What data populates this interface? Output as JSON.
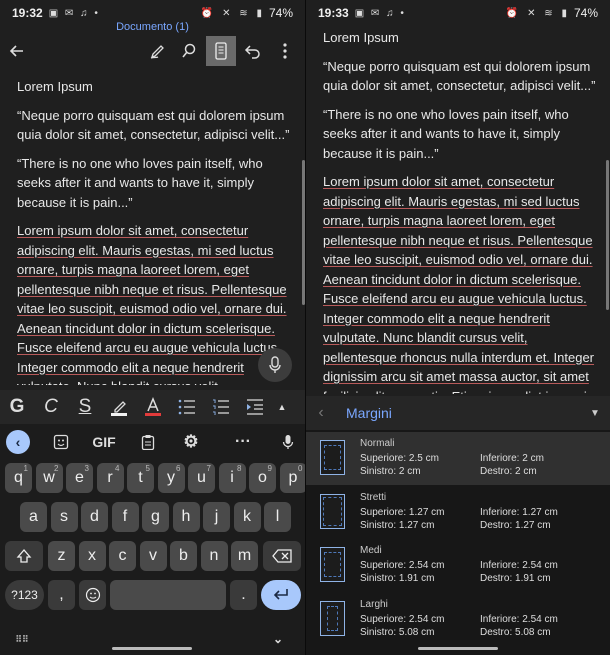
{
  "left": {
    "status": {
      "time": "19:32",
      "battery": "74%"
    },
    "doc_title": "Documento (1)",
    "doc": {
      "heading": "Lorem Ipsum",
      "quote1": "“Neque porro quisquam est qui dolorem ipsum quia dolor sit amet, consectetur, adipisci velit...”",
      "quote2": "“There is no one who loves pain itself, who seeks after it and wants to have it, simply because it is pain...”",
      "body": "Lorem ipsum dolor sit amet, consectetur adipiscing elit. Mauris egestas, mi sed luctus ornare, turpis magna laoreet lorem, eget pellentesque nibh neque et risus. Pellentesque vitae leo suscipit, euismod odio vel, ornare dui. Aenean tincidunt dolor in dictum scelerisque. Fusce eleifend arcu eu augue vehicula luctus. Integer commodo elit a neque hendrerit vulputate. Nunc blandit cursus velit,"
    },
    "format_bar": {
      "bold": "G",
      "italic": "C",
      "underline": "S"
    },
    "keyboard": {
      "gif": "GIF",
      "row1": [
        {
          "k": "q",
          "h": "1"
        },
        {
          "k": "w",
          "h": "2"
        },
        {
          "k": "e",
          "h": "3"
        },
        {
          "k": "r",
          "h": "4"
        },
        {
          "k": "t",
          "h": "5"
        },
        {
          "k": "y",
          "h": "6"
        },
        {
          "k": "u",
          "h": "7"
        },
        {
          "k": "i",
          "h": "8"
        },
        {
          "k": "o",
          "h": "9"
        },
        {
          "k": "p",
          "h": "0"
        }
      ],
      "row2": [
        "a",
        "s",
        "d",
        "f",
        "g",
        "h",
        "j",
        "k",
        "l"
      ],
      "row3": [
        "z",
        "x",
        "c",
        "v",
        "b",
        "n",
        "m"
      ],
      "sym": "?123",
      "comma": ",",
      "period": "."
    }
  },
  "right": {
    "status": {
      "time": "19:33",
      "battery": "74%"
    },
    "doc": {
      "heading": "Lorem Ipsum",
      "quote1": "“Neque porro quisquam est qui dolorem ipsum quia dolor sit amet, consectetur, adipisci velit...”",
      "quote2": "“There is no one who loves pain itself, who seeks after it and wants to have it, simply because it is pain...”",
      "body": "Lorem ipsum dolor sit amet, consectetur adipiscing elit. Mauris egestas, mi sed luctus ornare, turpis magna laoreet lorem, eget pellentesque nibh neque et risus. Pellentesque vitae leo suscipit, euismod odio vel, ornare dui. Aenean tincidunt dolor in dictum scelerisque. Fusce eleifend arcu eu augue vehicula luctus. Integer commodo elit a neque hendrerit vulputate. Nunc blandit cursus velit, pellentesque rhoncus nulla interdum et. Integer dignissim arcu sit amet massa auctor, sit amet facilisis elit venenatis. Etiam imperdiet ipsum in"
    },
    "margins_panel": {
      "title": "Margini",
      "options": [
        {
          "name": "Normali",
          "top": "Superiore: 2.5 cm",
          "left": "Sinistro: 2 cm",
          "bottom": "Inferiore: 2 cm",
          "right": "Destro: 2 cm",
          "selected": true
        },
        {
          "name": "Stretti",
          "top": "Superiore: 1.27 cm",
          "left": "Sinistro: 1.27 cm",
          "bottom": "Inferiore: 1.27 cm",
          "right": "Destro: 1.27 cm",
          "selected": false
        },
        {
          "name": "Medi",
          "top": "Superiore: 2.54 cm",
          "left": "Sinistro: 1.91 cm",
          "bottom": "Inferiore: 2.54 cm",
          "right": "Destro: 1.91 cm",
          "selected": false
        },
        {
          "name": "Larghi",
          "top": "Superiore: 2.54 cm",
          "left": "Sinistro: 5.08 cm",
          "bottom": "Inferiore: 2.54 cm",
          "right": "Destro: 5.08 cm",
          "selected": false
        }
      ]
    }
  },
  "colors": {
    "accent": "#7aa7ff",
    "key": "#4a4a4a",
    "enter_key": "#a8c8fb",
    "highlight_red": "#e23b3b"
  }
}
